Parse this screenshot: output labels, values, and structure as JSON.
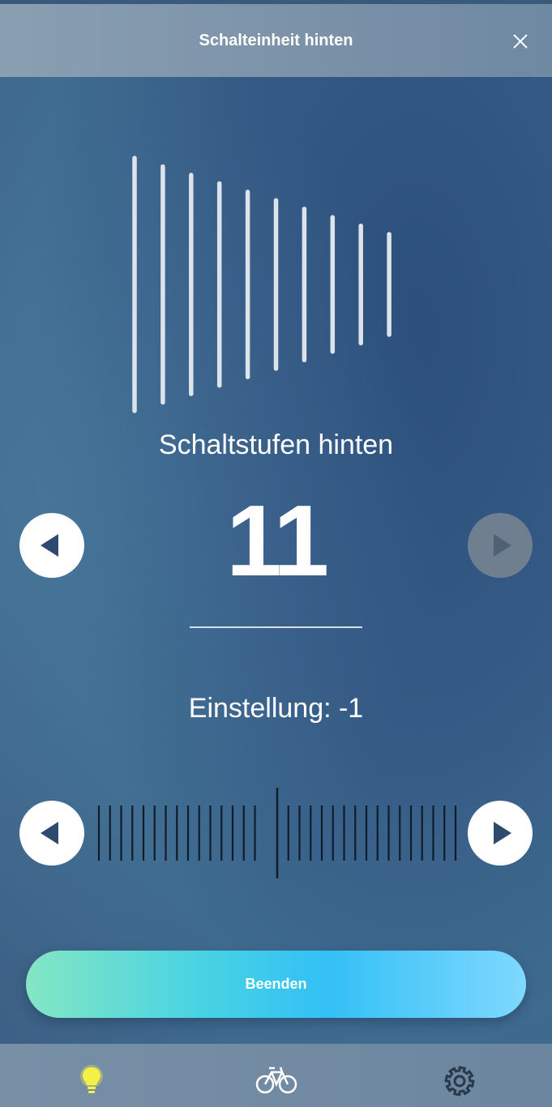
{
  "header": {
    "title": "Schalteinheit hinten",
    "close_icon": "close-icon"
  },
  "gear_indicator": {
    "total_gears": 11,
    "active_gear": 11,
    "active_color": "#2fe07a",
    "inactive_color": "#dde3ea"
  },
  "gears": {
    "label": "Schaltstufen hinten",
    "value": "11",
    "decrease_icon": "triangle-left-icon",
    "increase_icon": "triangle-right-icon",
    "increase_disabled": true
  },
  "adjustment": {
    "label": "Einstellung:  -1",
    "value": -1,
    "scale_min": -16,
    "scale_max": 16,
    "decrease_icon": "triangle-left-icon",
    "increase_icon": "triangle-right-icon",
    "marker_color": "#2fe07a"
  },
  "finish_button": {
    "label": "Beenden"
  },
  "bottom_nav": {
    "items": [
      {
        "icon": "lightbulb-icon",
        "active": true,
        "color": "#f5ef4a"
      },
      {
        "icon": "bicycle-icon",
        "active": false
      },
      {
        "icon": "gear-icon",
        "active": false
      }
    ]
  }
}
